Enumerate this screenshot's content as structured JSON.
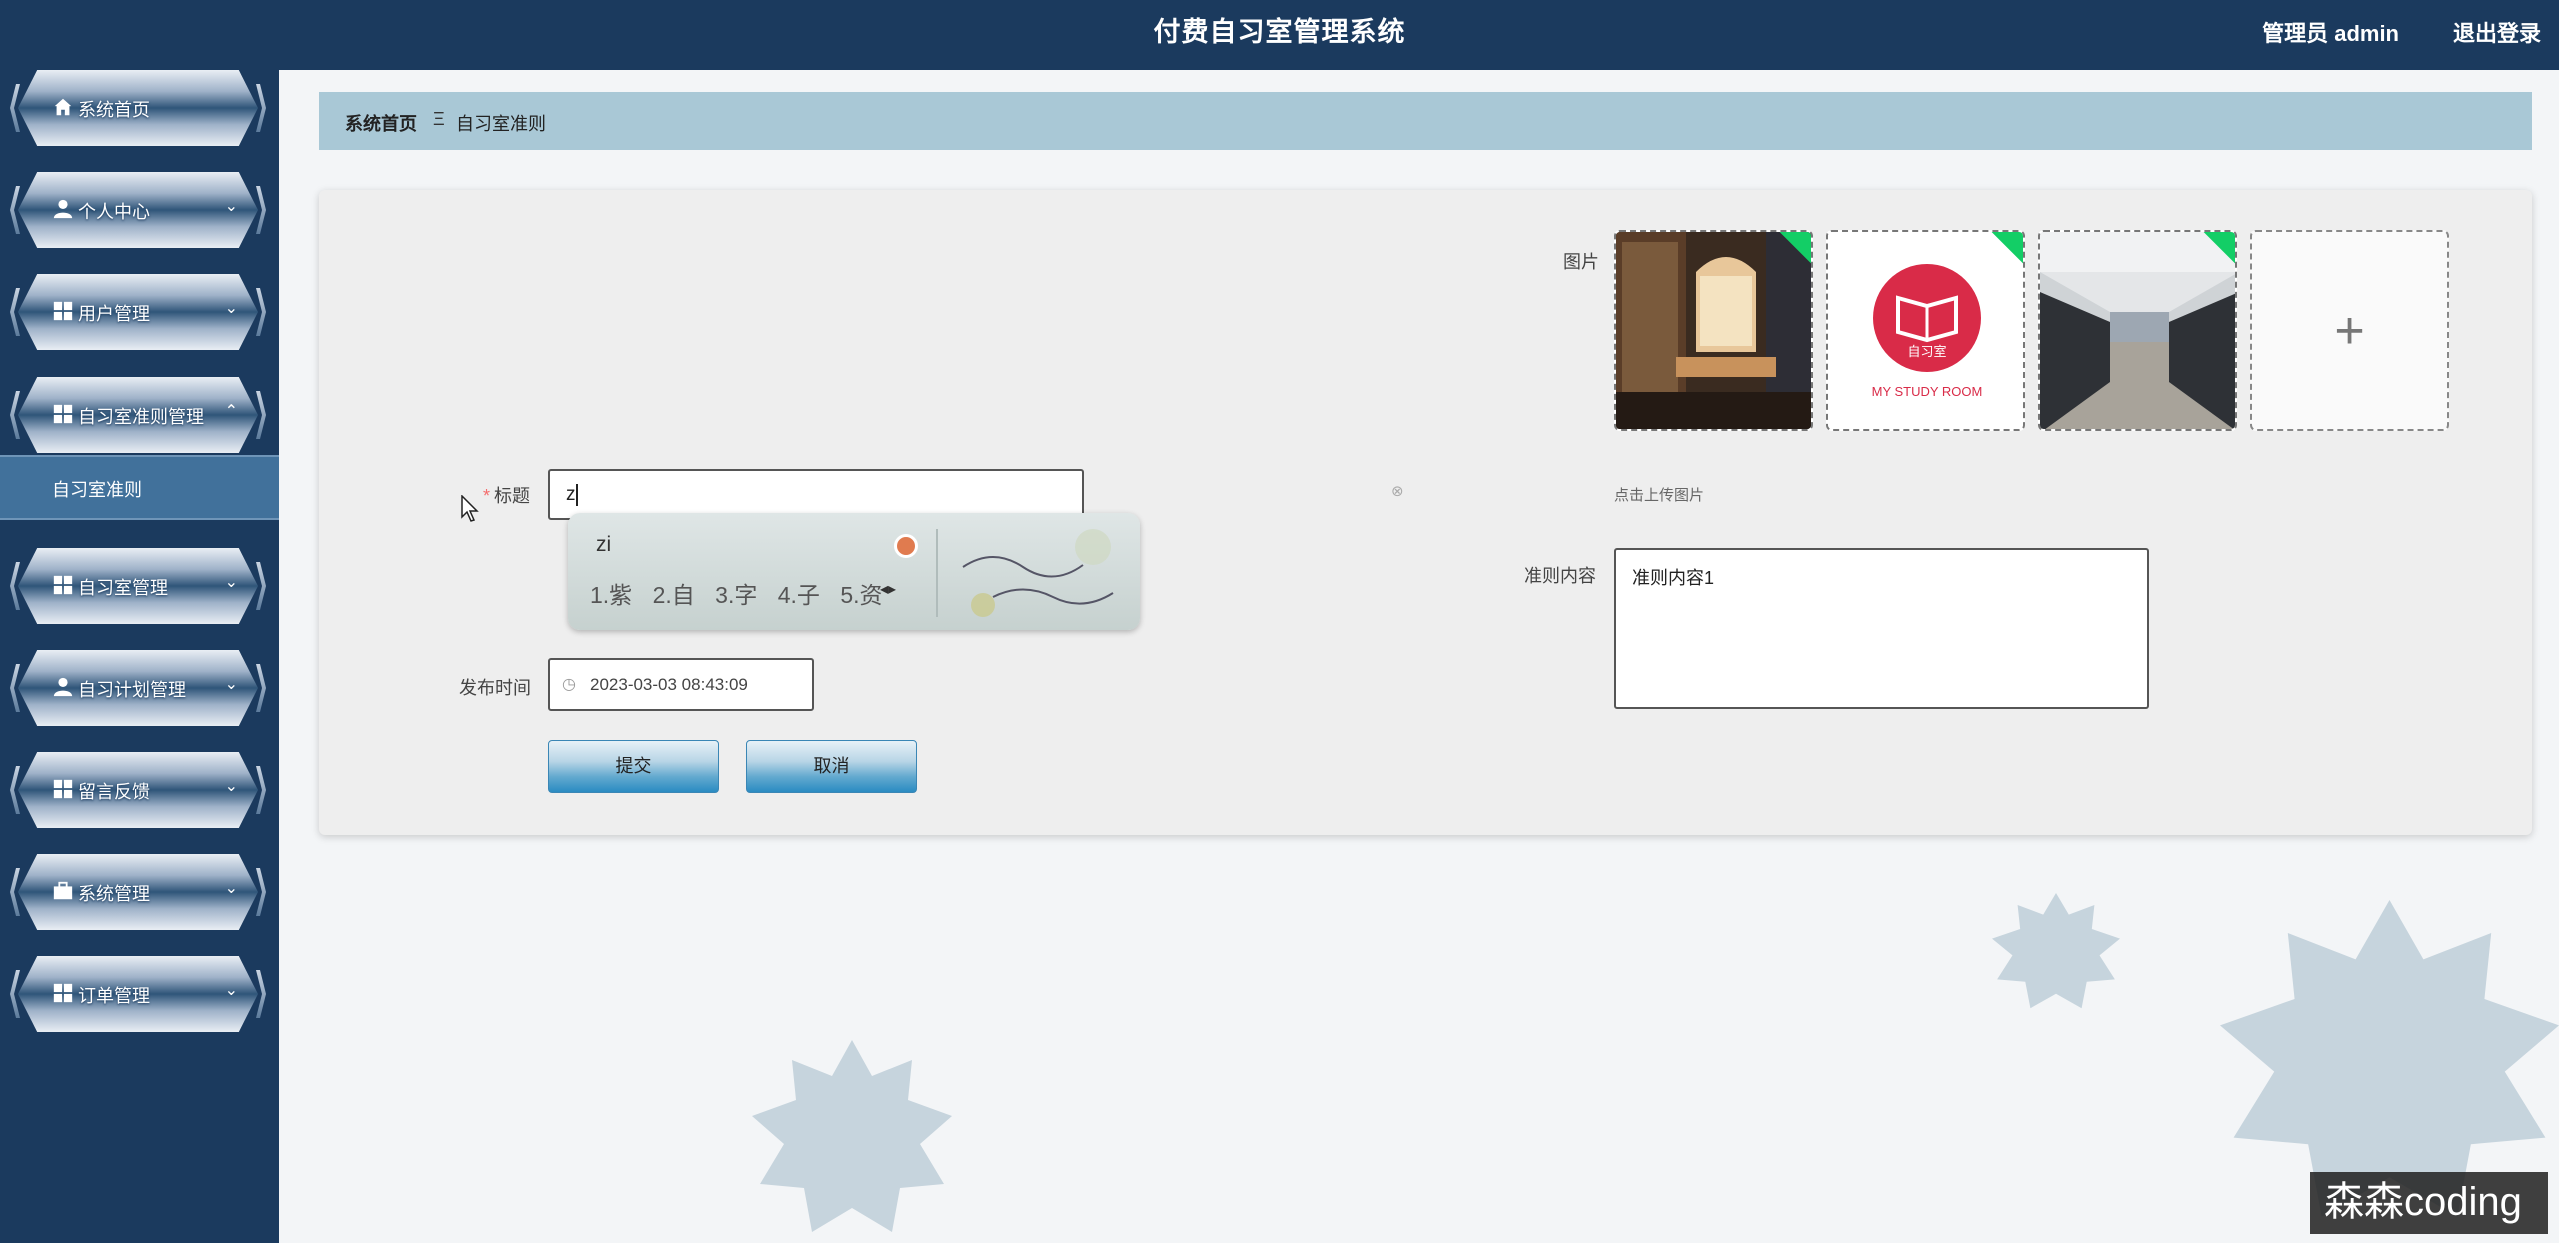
{
  "header": {
    "title": "付费自习室管理系统",
    "user": "管理员 admin",
    "logout": "退出登录"
  },
  "sidebar": {
    "items": [
      {
        "label": "系统首页",
        "icon": "home-icon"
      },
      {
        "label": "个人中心",
        "icon": "user-icon"
      },
      {
        "label": "用户管理",
        "icon": "grid-icon"
      },
      {
        "label": "自习室准则管理",
        "icon": "grid-icon"
      },
      {
        "label": "自习室管理",
        "icon": "grid-icon"
      },
      {
        "label": "自习计划管理",
        "icon": "user-icon"
      },
      {
        "label": "留言反馈",
        "icon": "grid-icon"
      },
      {
        "label": "系统管理",
        "icon": "briefcase-icon"
      },
      {
        "label": "订单管理",
        "icon": "grid-icon"
      }
    ],
    "sub_item": "自习室准则"
  },
  "breadcrumb": {
    "home": "系统首页",
    "separator": "Ξ",
    "current": "自习室准则"
  },
  "form": {
    "title_label": "标题",
    "title_value": "z",
    "time_label": "发布时间",
    "time_value": "2023-03-03 08:43:09",
    "image_label": "图片",
    "upload_hint": "点击上传图片",
    "content_label": "准则内容",
    "content_value": "准则内容1",
    "submit": "提交",
    "cancel": "取消"
  },
  "thumbnails": [
    {
      "name": "cafe-interior"
    },
    {
      "name": "study-room-logo",
      "logo_text": "自习室",
      "caption": "MY STUDY ROOM"
    },
    {
      "name": "study-hall-interior"
    }
  ],
  "ime": {
    "pinyin": "zi",
    "candidates": [
      "1.紫",
      "2.自",
      "3.字",
      "4.子",
      "5.资"
    ]
  },
  "watermark": "森森coding",
  "colors": {
    "header": "#1b3a5e",
    "breadcrumb": "#a9c8d6",
    "button": "#2a8bc2",
    "required": "#f56c6c"
  }
}
